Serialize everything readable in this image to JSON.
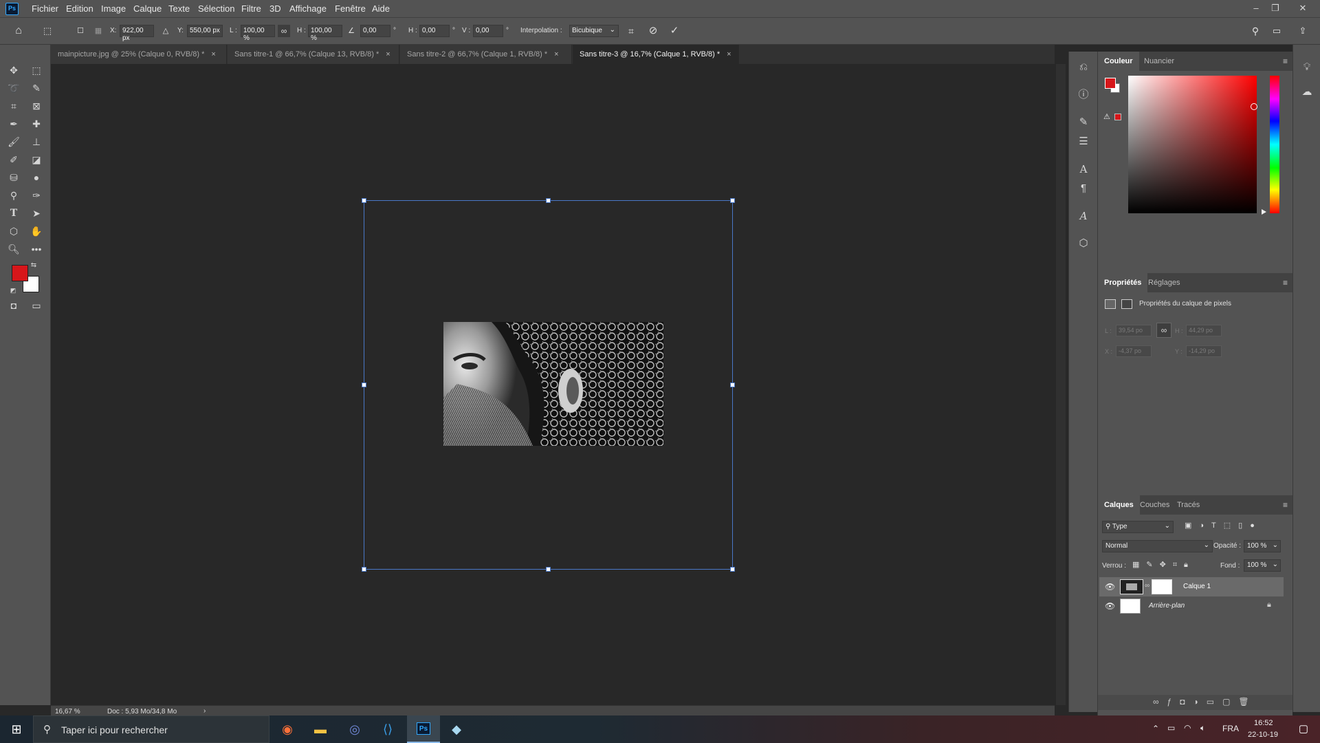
{
  "app": {
    "logo": "Ps"
  },
  "menu": [
    "Fichier",
    "Edition",
    "Image",
    "Calque",
    "Texte",
    "Sélection",
    "Filtre",
    "3D",
    "Affichage",
    "Fenêtre",
    "Aide"
  ],
  "options": {
    "x_label": "X:",
    "x_value": "922,00 px",
    "y_label": "Y:",
    "y_value": "550,00 px",
    "w_label": "L :",
    "w_value": "100,00 %",
    "h_label": "H :",
    "h_value": "100,00 %",
    "angle_value": "0,00",
    "deg": "°",
    "hskew_label": "H :",
    "hskew_value": "0,00",
    "vskew_label": "V :",
    "vskew_value": "0,00",
    "interp_label": "Interpolation :",
    "interp_value": "Bicubique"
  },
  "tabs": [
    {
      "label": "mainpicture.jpg @ 25% (Calque 0, RVB/8) *"
    },
    {
      "label": "Sans titre-1 @ 66,7% (Calque 13, RVB/8) *"
    },
    {
      "label": "Sans titre-2 @ 66,7% (Calque 1, RVB/8) *"
    },
    {
      "label": "Sans titre-3 @ 16,7% (Calque 1, RVB/8) *"
    }
  ],
  "tab_close": "×",
  "status": {
    "zoom": "16,67 %",
    "doc": "Doc : 5,93 Mo/34,8 Mo",
    "arrow": "›"
  },
  "color_panel": {
    "tab_active": "Couleur",
    "tab_other": "Nuancier",
    "foreground": "#d7161a",
    "background": "#ffffff"
  },
  "properties_panel": {
    "tab_active": "Propriétés",
    "tab_other": "Réglages",
    "subtitle": "Propriétés du calque de pixels",
    "l_label": "L :",
    "l_value": "39,54 po",
    "h_label": "H :",
    "h_value": "44,29 po",
    "x_label": "X :",
    "x_value": "-4,37 po",
    "y_label": "Y :",
    "y_value": "-14,29 po"
  },
  "layers_panel": {
    "tabs": [
      "Calques",
      "Couches",
      "Tracés"
    ],
    "filter": "Type",
    "blend_mode": "Normal",
    "opacity_label": "Opacité :",
    "opacity_value": "100 %",
    "lock_label": "Verrou :",
    "fill_label": "Fond :",
    "fill_value": "100 %",
    "layers": [
      {
        "name": "Calque 1",
        "selected": true
      },
      {
        "name": "Arrière-plan",
        "selected": false
      }
    ]
  },
  "taskbar": {
    "search_placeholder": "Taper ici pour rechercher",
    "lang": "FRA",
    "time": "16:52",
    "date": "22-10-19"
  }
}
